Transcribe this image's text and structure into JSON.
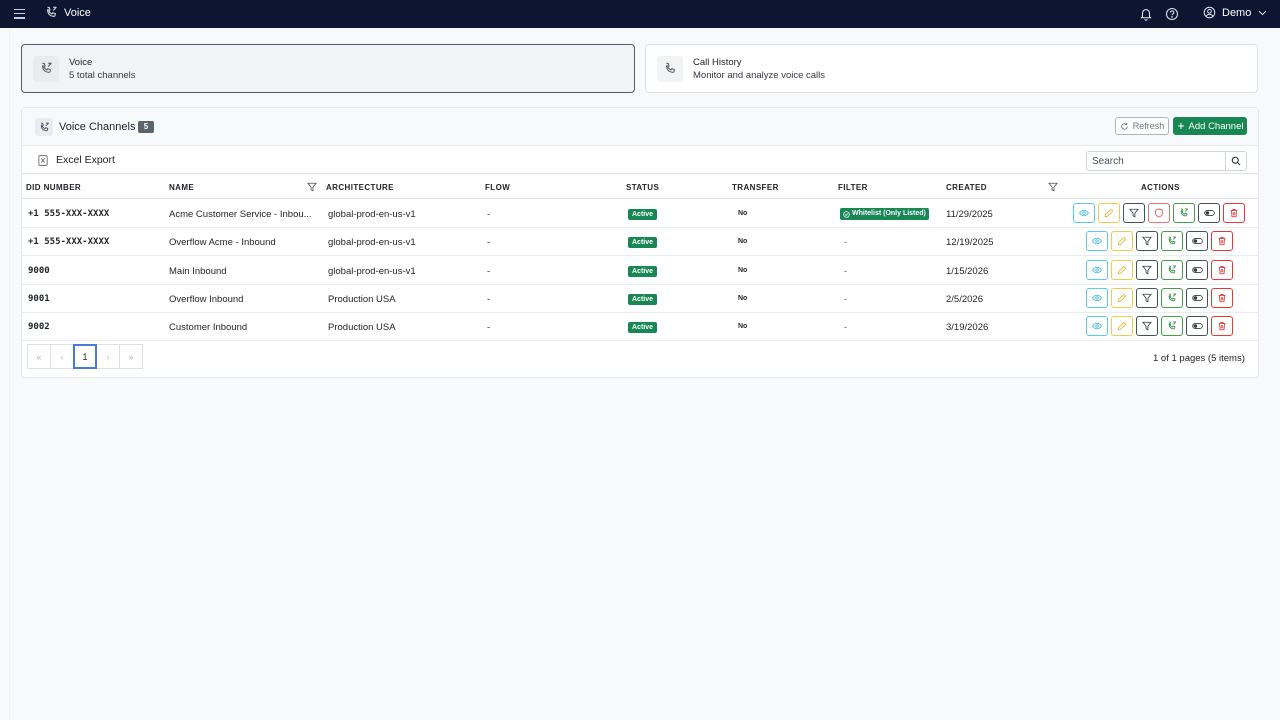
{
  "topbar": {
    "title": "Voice",
    "user_name": "Demo"
  },
  "cards": [
    {
      "title": "Voice",
      "subtitle": "5 total channels",
      "icon": "phone-wave-icon"
    },
    {
      "title": "Call History",
      "subtitle": "Monitor and analyze voice calls",
      "icon": "phone-icon"
    }
  ],
  "panel": {
    "title": "Voice Channels",
    "count": "5",
    "refresh_label": "Refresh",
    "add_label": "Add Channel",
    "export_label": "Excel Export",
    "search_placeholder": "Search"
  },
  "table": {
    "headers": {
      "did": "DID NUMBER",
      "name": "NAME",
      "architecture": "ARCHITECTURE",
      "flow": "FLOW",
      "status": "STATUS",
      "transfer": "TRANSFER",
      "filter": "FILTER",
      "created": "CREATED",
      "actions": "ACTIONS"
    },
    "rows": [
      {
        "did": "+1 555-XXX-XXXX",
        "name": "Acme Customer Service - Inbou...",
        "architecture": "global-prod-en-us-v1",
        "flow": "-",
        "status": "Active",
        "transfer": "No",
        "filter": "Whitelist (Only Listed)",
        "created": "11/29/2025"
      },
      {
        "did": "+1 555-XXX-XXXX",
        "name": "Overflow Acme - Inbound",
        "architecture": "global-prod-en-us-v1",
        "flow": "-",
        "status": "Active",
        "transfer": "No",
        "filter": "-",
        "created": "12/19/2025"
      },
      {
        "did": "9000",
        "name": "Main Inbound",
        "architecture": "global-prod-en-us-v1",
        "flow": "-",
        "status": "Active",
        "transfer": "No",
        "filter": "-",
        "created": "1/15/2026"
      },
      {
        "did": "9001",
        "name": "Overflow Inbound",
        "architecture": "Production USA",
        "flow": "-",
        "status": "Active",
        "transfer": "No",
        "filter": "-",
        "created": "2/5/2026"
      },
      {
        "did": "9002",
        "name": "Customer Inbound",
        "architecture": "Production USA",
        "flow": "-",
        "status": "Active",
        "transfer": "No",
        "filter": "-",
        "created": "3/19/2026"
      }
    ]
  },
  "pagination": {
    "first": "«",
    "prev": "‹",
    "current": "1",
    "next": "›",
    "last": "»",
    "info": "1 of 1 pages (5 items)"
  },
  "colors": {
    "topbar": "#0d1530",
    "success": "#198754",
    "badge": "#5c636a"
  }
}
